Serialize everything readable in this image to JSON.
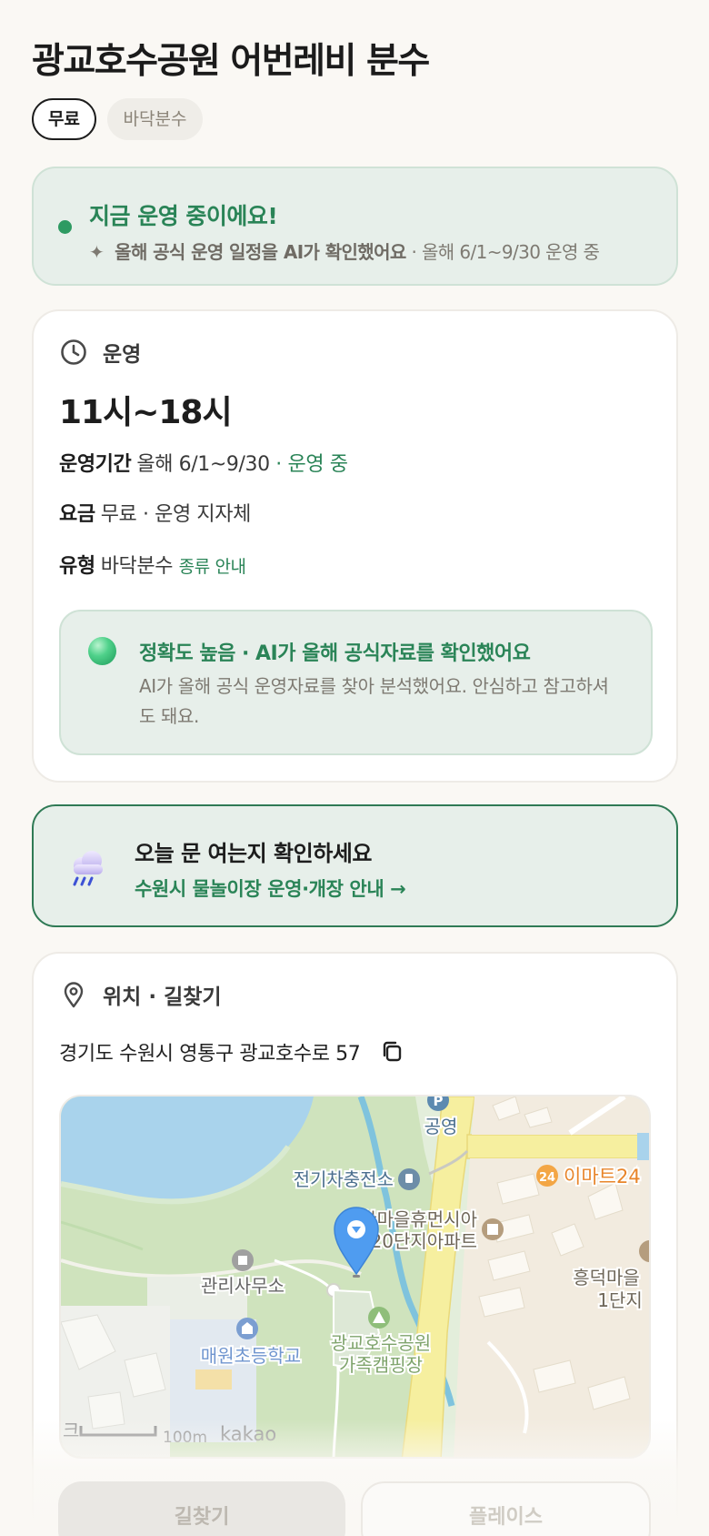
{
  "page": {
    "title": "광교호수공원 어번레비 분수",
    "chips": {
      "fee": "무료",
      "type": "바닥분수"
    }
  },
  "status": {
    "title": "지금 운영 중이에요!",
    "sparkle": "✦",
    "ai_note": "올해 공식 운영 일정을 AI가 확인했어요",
    "period_note": "· 올해 6/1~9/30 운영 중",
    "dot_color": "#2e9a62"
  },
  "hours_card": {
    "header": "운영",
    "hours": "11시~18시",
    "period_label": "운영기간",
    "period_value": "올해 6/1~9/30",
    "period_status": "· 운영 중",
    "fee_label": "요금",
    "fee_value": "무료 · 운영 지자체",
    "type_label": "유형",
    "type_value": "바닥분수",
    "type_link": "종류 안내",
    "accuracy": {
      "title": "정확도 높음 · AI가 올해 공식자료를 확인했어요",
      "desc": "AI가 올해 공식 운영자료를 찾아 분석했어요. 안심하고 참고하셔도 돼요."
    }
  },
  "notice": {
    "title": "오늘 문 여는지 확인하세요",
    "link": "수원시 물놀이장 운영·개장 안내 →"
  },
  "location_card": {
    "header": "위치 · 길찾기",
    "address": "경기도 수원시 영통구 광교호수로 57",
    "map": {
      "labels": {
        "parking": "공영",
        "ev": "전기차충전소",
        "emart": "이마트24",
        "apt1": "한마을휴먼시아",
        "apt2": "20단지아파트",
        "office": "관리사무소",
        "school": "매원초등학교",
        "camp1": "광교호수공원",
        "camp2": "가족캠핑장",
        "east1": "흥덕마을",
        "east2": "1단지",
        "scale": "100m",
        "brand": "kakao",
        "cut": "크"
      }
    }
  },
  "actions": {
    "directions": "길찾기",
    "place": "플레이스"
  },
  "colors": {
    "accent_green": "#2a8457",
    "background": "#faf8f4"
  }
}
